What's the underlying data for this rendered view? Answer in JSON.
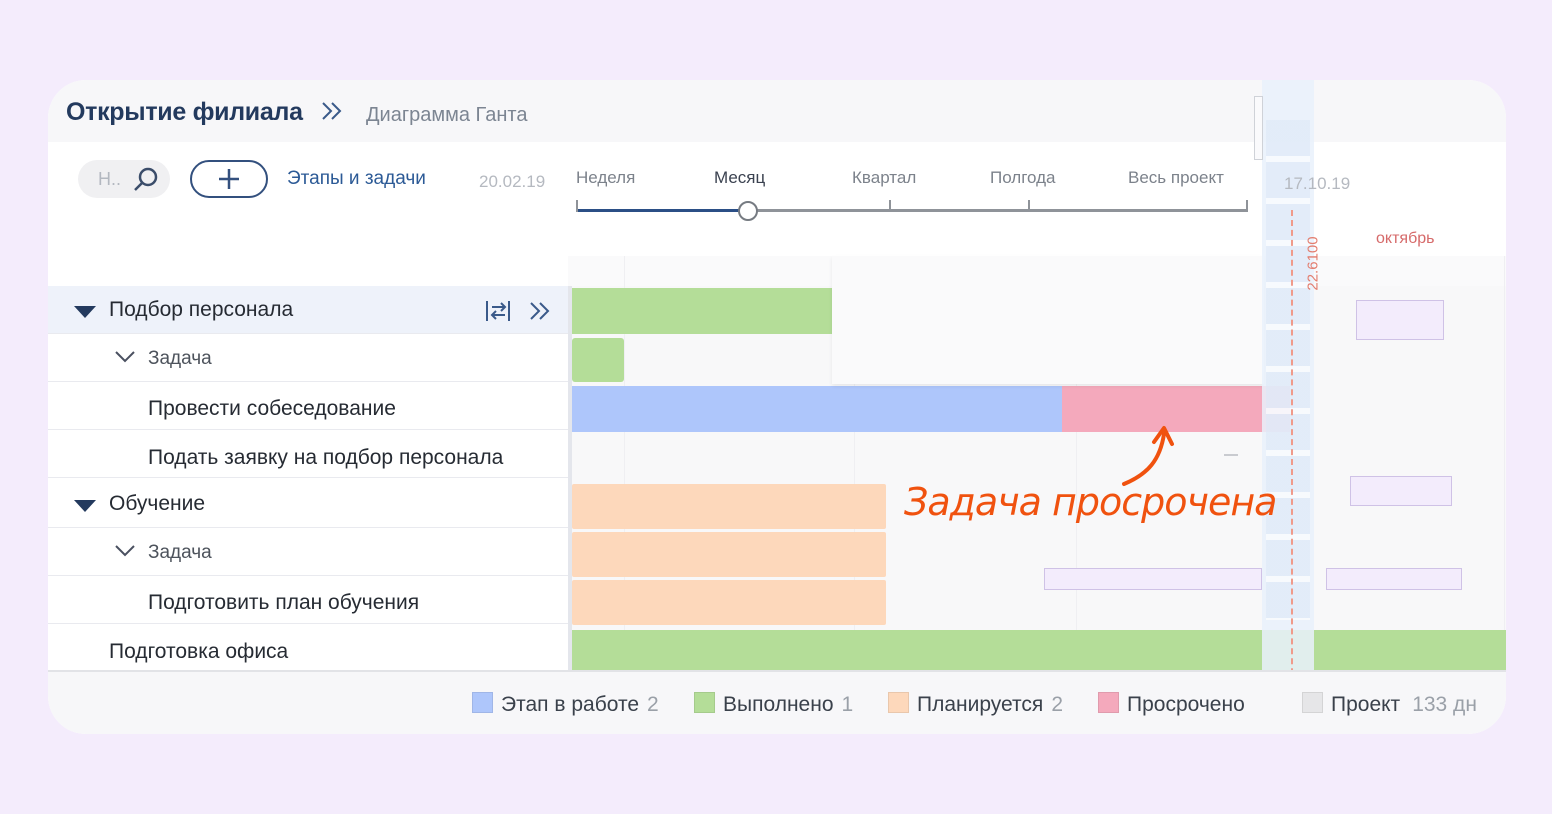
{
  "header": {
    "title": "Открытие филиала",
    "breadcrumb": "Диаграмма Ганта"
  },
  "toolbar": {
    "search_placeholder": "Н..",
    "tasks_link": "Этапы и задачи",
    "start_date": "20.02.19",
    "end_date": "17.10.19"
  },
  "scale": {
    "options": [
      "Неделя",
      "Месяц",
      "Квартал",
      "Полгода",
      "Весь проект"
    ],
    "selected": "Месяц"
  },
  "timeline": {
    "month_label": "октябрь",
    "today_label": "22.6100"
  },
  "tree": [
    {
      "label": "Подбор персонала",
      "kind": "stage",
      "selected": true
    },
    {
      "label": "Задача",
      "kind": "group"
    },
    {
      "label": "Провести собеседование",
      "kind": "task"
    },
    {
      "label": "Подать  заявку на подбор персонала",
      "kind": "task"
    },
    {
      "label": "Обучение",
      "kind": "stage"
    },
    {
      "label": "Задача",
      "kind": "group"
    },
    {
      "label": "Подготовить план обучения",
      "kind": "task"
    },
    {
      "label": "Подготовка офиса",
      "kind": "stage"
    }
  ],
  "annotation": "Задача просрочена",
  "legend": [
    {
      "label": "Этап в работе",
      "count": "2",
      "color": "#aec6fb"
    },
    {
      "label": "Выполнено",
      "count": "1",
      "color": "#b4dd98"
    },
    {
      "label": "Планируется",
      "count": "2",
      "color": "#fdd8bb"
    },
    {
      "label": "Просрочено",
      "count": "",
      "color": "#f4a9bc"
    },
    {
      "label": "Проект",
      "count": "133 дн",
      "color": "#e6e6e8"
    }
  ],
  "icons": [
    "search-icon",
    "plus-icon",
    "chevron-right-double-icon",
    "collapse-triangle-icon",
    "chevron-down-icon",
    "fit-width-icon",
    "expand-double-chevron-icon"
  ]
}
